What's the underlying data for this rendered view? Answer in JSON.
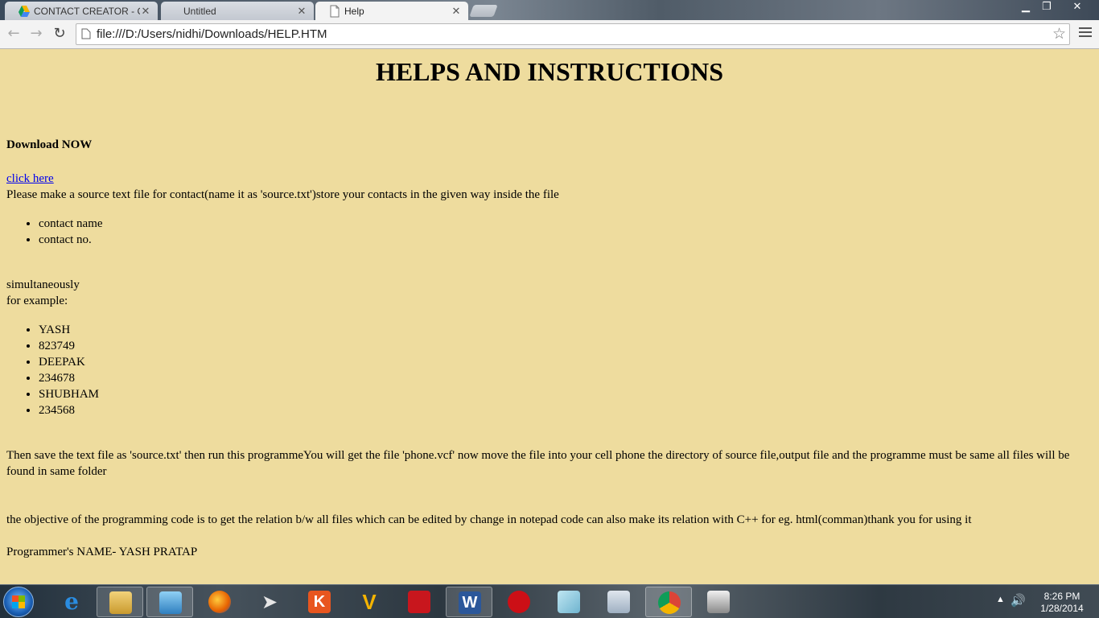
{
  "browser": {
    "tabs": [
      {
        "title": "CONTACT CREATOR - Go",
        "icon": "google-drive-icon",
        "active": false
      },
      {
        "title": "Untitled",
        "icon": "none",
        "active": false
      },
      {
        "title": "Help",
        "icon": "page-icon",
        "active": true
      }
    ],
    "window_controls": {
      "minimize": "▁",
      "restore": "❐",
      "close": "✕"
    },
    "url": "file:///D:/Users/nidhi/Downloads/HELP.HTM"
  },
  "page": {
    "heading": "HELPS AND INSTRUCTIONS",
    "download_title": "Download NOW",
    "download_link": "click here",
    "intro": "Please make a source text file for contact(name it as 'source.txt')store your contacts in the given way inside the file",
    "format_items": [
      "contact name",
      "contact no."
    ],
    "simultaneously": "simultaneously",
    "for_example": "for example:",
    "example_items": [
      "YASH",
      "823749",
      "DEEPAK",
      "234678",
      "SHUBHAM",
      "234568"
    ],
    "save_instructions": "Then save the text file as 'source.txt' then run this programmeYou will get the file 'phone.vcf' now move the file into your cell phone the directory of source file,output file and the programme must be same all files will be found in same folder",
    "objective": "the objective of the programming code is to get the relation b/w all files which can be edited by change in notepad code can also make its relation with C++ for eg. html(comman)thank you for using it",
    "programmer": "Programmer's NAME- YASH PRATAP"
  },
  "taskbar": {
    "apps": [
      "internet-explorer-icon",
      "windows-explorer-icon",
      "media-player-icon",
      "firefox-icon",
      "send-icon",
      "kingsoft-icon",
      "vlc-icon",
      "acrobat-icon",
      "word-icon",
      "opera-icon",
      "notes-icon",
      "calculator-icon",
      "chrome-icon",
      "cat-app-icon"
    ],
    "time": "8:26 PM",
    "date": "1/28/2014"
  }
}
